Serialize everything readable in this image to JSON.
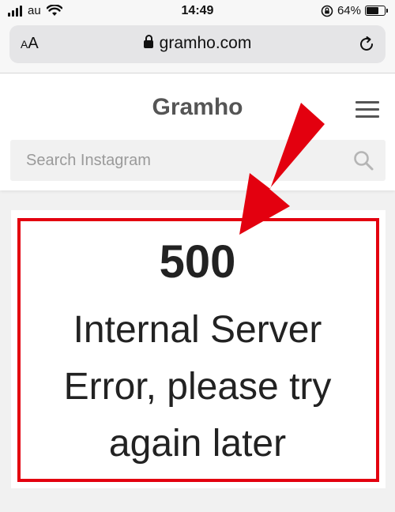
{
  "statusbar": {
    "carrier": "au",
    "time": "14:49",
    "battery_text": "64%",
    "battery_level": 0.64
  },
  "browser": {
    "text_size_button": {
      "small": "A",
      "large": "A"
    },
    "url": "gramho.com"
  },
  "site": {
    "brand": "Gramho",
    "search": {
      "placeholder": "Search Instagram",
      "value": ""
    }
  },
  "error": {
    "code": "500",
    "message": "Internal Server Error, please try again later"
  },
  "icons": {
    "wifi": "wifi-icon",
    "signal": "cellular-signal-icon",
    "orientation_lock": "orientation-lock-icon",
    "battery": "battery-icon",
    "lock": "lock-icon",
    "reload": "reload-icon",
    "menu": "hamburger-menu-icon",
    "search": "search-icon",
    "arrow": "red-arrow-annotation"
  },
  "colors": {
    "annotation_red": "#e3000f",
    "brand_gray": "#555555",
    "page_bg": "#f1f1f1"
  }
}
